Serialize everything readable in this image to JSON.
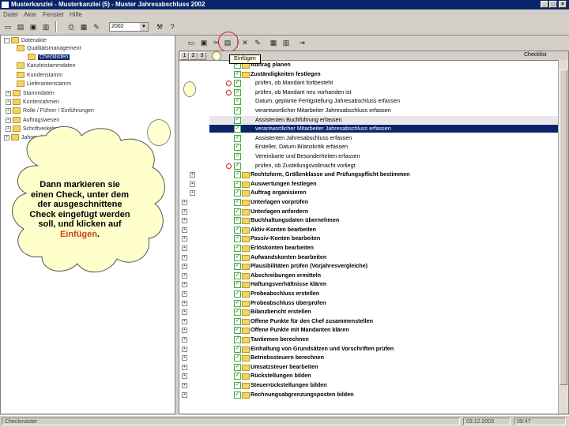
{
  "window": {
    "title": "Musterkanzlei - Musterkanzlei (5) - Muster Jahresabschluss 2002"
  },
  "menu": [
    "Datei",
    "Akte",
    "Fenster",
    "Hilfe"
  ],
  "toolbar": {
    "year": "2002"
  },
  "tree": [
    {
      "label": "Datenakte",
      "level": 0
    },
    {
      "label": "Qualitätsmanagement",
      "level": 1
    },
    {
      "label": "Checklisten",
      "level": 2,
      "selected": true
    },
    {
      "label": "Kanzleistammdaten",
      "level": 1
    },
    {
      "label": "Kundenstamm",
      "level": 1
    },
    {
      "label": "Lieferantenstamm",
      "level": 1
    },
    {
      "label": "Stammdaten",
      "level": 1
    },
    {
      "label": "Kontenrahmen",
      "level": 1
    },
    {
      "label": "Rolle / Führer / Einführungen",
      "level": 1
    },
    {
      "label": "Auftragswesen",
      "level": 1
    },
    {
      "label": "Schriftverkehr",
      "level": 1
    },
    {
      "label": "Jahresakte",
      "level": 0
    }
  ],
  "callout": {
    "text_before": "Dann markieren sie einen Check, unter dem der ausgeschnittene Check eingefügt werden soll, und klicken auf ",
    "highlight": "Einfügen",
    "text_after": "."
  },
  "tooltip": "Einfügen",
  "grid": {
    "headers": [
      "1",
      "2",
      "3"
    ],
    "checklist_label": "Checklist",
    "rows": [
      {
        "text": "Auftrag planen",
        "bold": true
      },
      {
        "text": "Zuständigkeiten festlegen",
        "bold": true
      },
      {
        "text": "prüfen, ob Mandant fortbesteht",
        "bold": false,
        "mark": true
      },
      {
        "text": "prüfen, ob Mandant neu vorhanden ist",
        "bold": false,
        "mark": true
      },
      {
        "text": "Datum, geplante Fertigstellung Jahresabschluss erfassen",
        "bold": false
      },
      {
        "text": "verantwortlicher Mitarbeiter Jahresabschluss erfassen",
        "bold": false
      },
      {
        "text": "Assistenten Buchführung erfassen",
        "bold": false,
        "shade": true
      },
      {
        "text": "verantwortlicher Mitarbeiter Jahresabschluss erfassen",
        "bold": false,
        "selected": true
      },
      {
        "text": "Assistenten Jahresabschluss erfassen",
        "bold": false
      },
      {
        "text": "Ersteller, Datum Bilanzkritik erfassen",
        "bold": false
      },
      {
        "text": "Vereinbarte und Besonderheiten erfassen",
        "bold": false
      },
      {
        "text": "prüfen, ob Zustellungsvollmacht vorliegt",
        "bold": false,
        "mark": true
      },
      {
        "text": "Rechtsform, Größenklasse und Prüfungspflicht bestimmen",
        "bold": true
      },
      {
        "text": "Auswertungen festlegen",
        "bold": true
      },
      {
        "text": "Auftrag organisieren",
        "bold": true
      },
      {
        "text": "Unterlagen vorprüfen",
        "bold": true
      },
      {
        "text": "Unterlagen anfordern",
        "bold": true
      },
      {
        "text": "Buchhaltungsdaten übernehmen",
        "bold": true
      },
      {
        "text": "Aktiv-Konten bearbeiten",
        "bold": true
      },
      {
        "text": "Passiv-Konten bearbeiten",
        "bold": true
      },
      {
        "text": "Erlöskonten bearbeiten",
        "bold": true
      },
      {
        "text": "Aufwandskonten bearbeiten",
        "bold": true
      },
      {
        "text": "Plausibilitäten prüfen (Vorjahresvergleiche)",
        "bold": true
      },
      {
        "text": "Abschreibungen ermitteln",
        "bold": true
      },
      {
        "text": "Haftungsverhältnisse klären",
        "bold": true
      },
      {
        "text": "Probeabschluss erstellen",
        "bold": true
      },
      {
        "text": "Probeabschluss überprüfen",
        "bold": true
      },
      {
        "text": "Bilanzbericht erstellen",
        "bold": true
      },
      {
        "text": "Offene Punkte für den Chef zusammenstellen",
        "bold": true
      },
      {
        "text": "Offene Punkte mit Mandanten klären",
        "bold": true
      },
      {
        "text": "Tantiemen berechnen",
        "bold": true
      },
      {
        "text": "Einhaltung von Grundsätzen und Vorschriften prüfen",
        "bold": true
      },
      {
        "text": "Betriebssteuern berechnen",
        "bold": true
      },
      {
        "text": "Umsatzsteuer bearbeiten",
        "bold": true
      },
      {
        "text": "Rückstellungen bilden",
        "bold": true
      },
      {
        "text": "Steuerrückstellungen bilden",
        "bold": true
      },
      {
        "text": "Rechnungsabgrenzungsposten bilden",
        "bold": true
      }
    ]
  },
  "status": {
    "left": "Checkmaster",
    "date": "03.12.2003",
    "time": "09:47"
  },
  "colors": {
    "titlebar": "#0a246a",
    "highlight": "#d04010",
    "callout": "#ffffcc"
  }
}
